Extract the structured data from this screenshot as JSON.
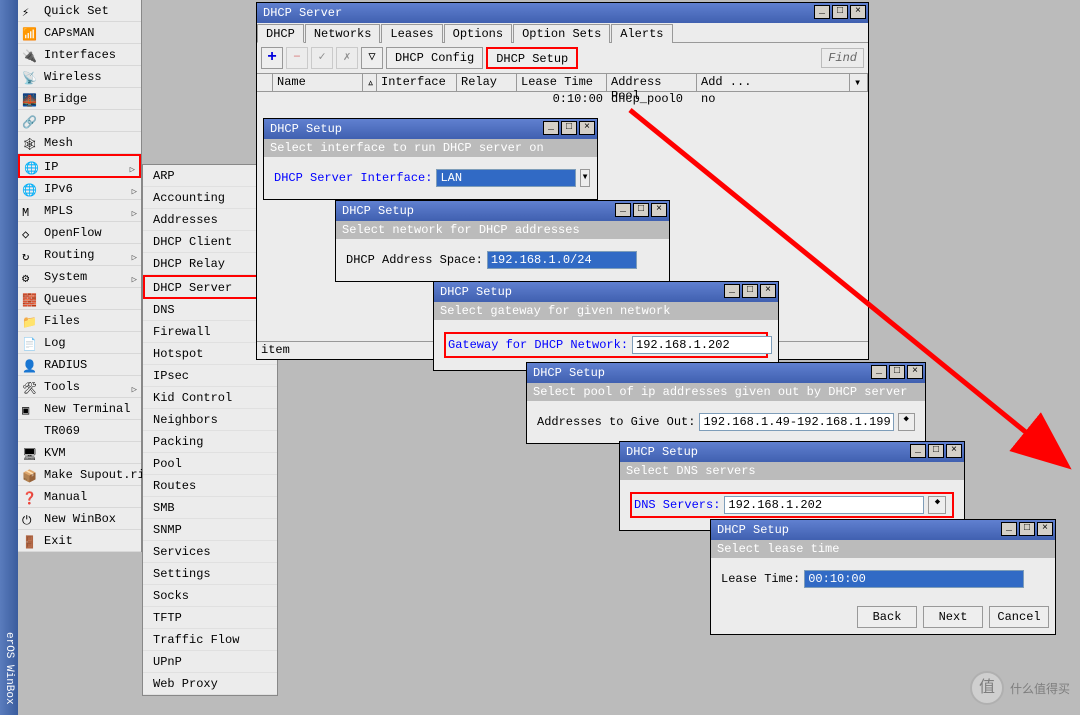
{
  "sidebar_label": "erOS WinBox",
  "menu": [
    {
      "icon": "⚡",
      "label": "Quick Set"
    },
    {
      "icon": "📶",
      "label": "CAPsMAN"
    },
    {
      "icon": "🔌",
      "label": "Interfaces"
    },
    {
      "icon": "📡",
      "label": "Wireless"
    },
    {
      "icon": "🌉",
      "label": "Bridge"
    },
    {
      "icon": "🔗",
      "label": "PPP"
    },
    {
      "icon": "🕸",
      "label": "Mesh"
    },
    {
      "icon": "🌐",
      "label": "IP",
      "expand": true,
      "hl": true
    },
    {
      "icon": "🌐",
      "label": "IPv6",
      "expand": true
    },
    {
      "icon": "M",
      "label": "MPLS",
      "expand": true
    },
    {
      "icon": "◇",
      "label": "OpenFlow"
    },
    {
      "icon": "↻",
      "label": "Routing",
      "expand": true
    },
    {
      "icon": "⚙",
      "label": "System",
      "expand": true
    },
    {
      "icon": "🧱",
      "label": "Queues"
    },
    {
      "icon": "📁",
      "label": "Files"
    },
    {
      "icon": "📄",
      "label": "Log"
    },
    {
      "icon": "👤",
      "label": "RADIUS"
    },
    {
      "icon": "🛠",
      "label": "Tools",
      "expand": true
    },
    {
      "icon": "▣",
      "label": "New Terminal"
    },
    {
      "icon": "",
      "label": "TR069"
    },
    {
      "icon": "🖥",
      "label": "KVM"
    },
    {
      "icon": "📦",
      "label": "Make Supout.rif"
    },
    {
      "icon": "❓",
      "label": "Manual"
    },
    {
      "icon": "⏻",
      "label": "New WinBox"
    },
    {
      "icon": "🚪",
      "label": "Exit"
    }
  ],
  "submenu": [
    "ARP",
    "Accounting",
    "Addresses",
    "DHCP Client",
    "DHCP Relay",
    "DHCP Server",
    "DNS",
    "Firewall",
    "Hotspot",
    "IPsec",
    "Kid Control",
    "Neighbors",
    "Packing",
    "Pool",
    "Routes",
    "SMB",
    "SNMP",
    "Services",
    "Settings",
    "Socks",
    "TFTP",
    "Traffic Flow",
    "UPnP",
    "Web Proxy"
  ],
  "submenu_hl": "DHCP Server",
  "mainwin": {
    "title": "DHCP Server",
    "tabs": [
      "DHCP",
      "Networks",
      "Leases",
      "Options",
      "Option Sets",
      "Alerts"
    ],
    "dhcp_config": "DHCP Config",
    "dhcp_setup": "DHCP Setup",
    "find": "Find",
    "headers": [
      "Name",
      "Interface",
      "Relay",
      "Lease Time",
      "Address Pool",
      "Add ..."
    ],
    "row": {
      "lease": "0:10:00",
      "pool": "dhcp_pool0",
      "add": "no"
    },
    "status": "item"
  },
  "dlg1": {
    "title": "DHCP Setup",
    "sub": "Select interface to run DHCP server on",
    "label": "DHCP Server Interface:",
    "val": "LAN"
  },
  "dlg2": {
    "title": "DHCP Setup",
    "sub": "Select network for DHCP addresses",
    "label": "DHCP Address Space:",
    "val": "192.168.1.0/24"
  },
  "dlg3": {
    "title": "DHCP Setup",
    "sub": "Select gateway for given network",
    "label": "Gateway for DHCP Network:",
    "val": "192.168.1.202"
  },
  "dlg4": {
    "title": "DHCP Setup",
    "sub": "Select pool of ip addresses given out by DHCP server",
    "label": "Addresses to Give Out:",
    "val": "192.168.1.49-192.168.1.199"
  },
  "dlg5": {
    "title": "DHCP Setup",
    "sub": "Select DNS servers",
    "label": "DNS Servers:",
    "val": "192.168.1.202"
  },
  "dlg6": {
    "title": "DHCP Setup",
    "sub": "Select lease time",
    "label": "Lease Time:",
    "val": "00:10:00",
    "back": "Back",
    "next": "Next",
    "cancel": "Cancel"
  },
  "watermark": "什么值得买"
}
